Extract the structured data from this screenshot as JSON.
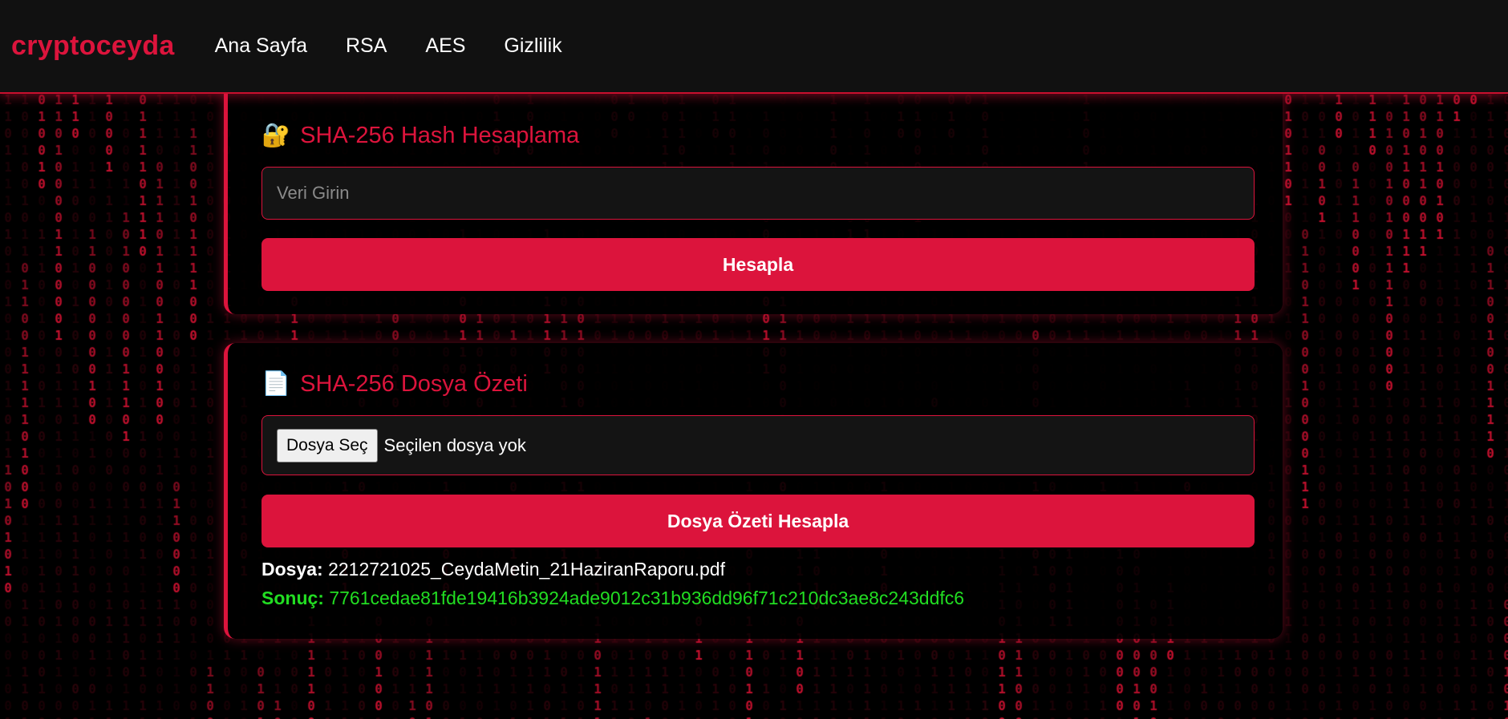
{
  "brand": "cryptoceyda",
  "nav": {
    "home": "Ana Sayfa",
    "rsa": "RSA",
    "aes": "AES",
    "privacy": "Gizlilik"
  },
  "hash_card": {
    "icon": "lock-with-key-icon",
    "title": "SHA-256 Hash Hesaplama",
    "input_placeholder": "Veri Girin",
    "input_value": "",
    "button_label": "Hesapla"
  },
  "file_card": {
    "icon": "document-icon",
    "title": "SHA-256 Dosya Özeti",
    "choose_file_label": "Dosya Seç",
    "no_file_text": "Seçilen dosya yok",
    "button_label": "Dosya Özeti Hesapla",
    "file_label": "Dosya:",
    "file_name": "2212721025_CeydaMetin_21HaziranRaporu.pdf",
    "result_label": "Sonuç:",
    "result_hash": "7761cedae81fde19416b3924ade9012c31b936dd96f71c210dc3ae8c243ddfc6"
  },
  "colors": {
    "accent": "#dc143c",
    "navbar_bg": "#111111",
    "result_green": "#22dd22",
    "matrix_digit": "#b0102a",
    "page_bg": "#000000"
  }
}
